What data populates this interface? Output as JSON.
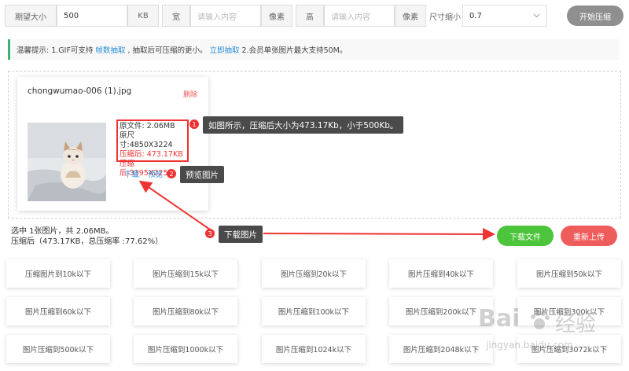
{
  "toolbar": {
    "size_label": "期望大小",
    "size_value": "500",
    "size_unit": "KB",
    "width_label": "宽",
    "width_placeholder": "请输入内容",
    "width_unit": "像素",
    "height_label": "高",
    "height_placeholder": "请输入内容",
    "height_unit": "像素",
    "scale_label": "尺寸缩小",
    "scale_value": "0.7",
    "start_label": "开始压缩"
  },
  "notice": {
    "prefix": "温馨提示: 1.GIF可支持",
    "link1": "帧数抽取",
    "middle": ", 抽取后可压缩的更小。",
    "link2": "立即抽取",
    "suffix": "2.会员单张图片最大支持50M。"
  },
  "file": {
    "name": "chongwumao-006 (1).jpg",
    "delete_label": "删除",
    "orig_size": "原文件: 2.06MB",
    "orig_dim": "原尺寸:4850X3224",
    "comp_size": "压缩后: 473.17KB",
    "comp_dim": "压缩后:3395X2256",
    "download_label": "下载",
    "preview_label": "预览"
  },
  "annotations": [
    {
      "num": "1",
      "text": "如图所示，压缩后大小为473.17Kb，小于500Kb。"
    },
    {
      "num": "2",
      "text": "预览图片"
    },
    {
      "num": "3",
      "text": "下载图片"
    }
  ],
  "summary": {
    "line1": "选中 1张图片，共 2.06MB。",
    "line2": "压缩后（473.17KB，总压缩率 :77.62%）"
  },
  "actions": {
    "download_all": "下载文件",
    "reupload": "重新上传"
  },
  "presets": [
    "压缩图片到10k以下",
    "图片压缩到15k以下",
    "图片压缩到20k以下",
    "图片压缩到40k以下",
    "图片压缩到50k以下",
    "图片压缩到60k以下",
    "图片压缩到80k以下",
    "图片压缩到100k以下",
    "图片压缩到200k以下",
    "图片压缩到300k以下",
    "图片压缩到500k以下",
    "图片压缩到1000k以下",
    "图片压缩到1024k以下",
    "图片压缩到2048k以下",
    "图片压缩到3072k以下"
  ],
  "watermark": {
    "brand": "Bai",
    "cn": "经验",
    "url": "jingyan.baidu.com"
  },
  "colors": {
    "accent_blue": "#2a8fd8",
    "green": "#4cc43c",
    "red": "#ef5c5c",
    "annotation_red": "#e33",
    "gray_button": "#8f8f8f"
  }
}
